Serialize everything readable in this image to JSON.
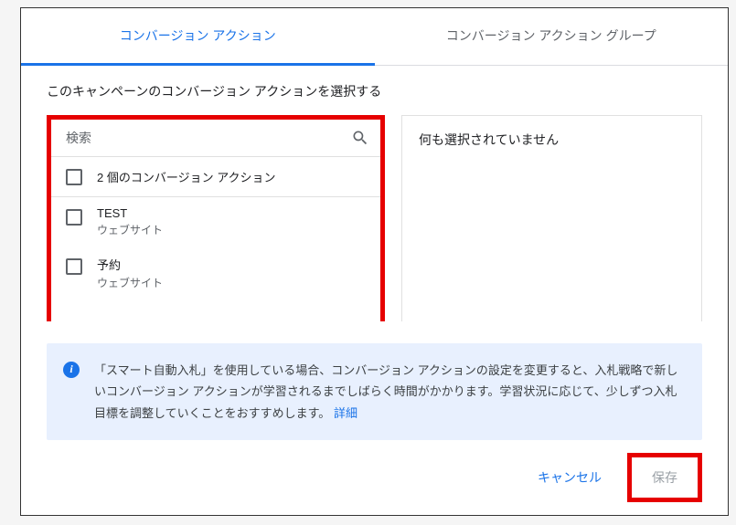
{
  "tabs": {
    "actions": "コンバージョン アクション",
    "groups": "コンバージョン アクション グループ"
  },
  "headline": "このキャンペーンのコンバージョン アクションを選択する",
  "search": {
    "placeholder": "検索"
  },
  "select_all": "2 個のコンバージョン アクション",
  "items": [
    {
      "name": "TEST",
      "sub": "ウェブサイト"
    },
    {
      "name": "予約",
      "sub": "ウェブサイト"
    }
  ],
  "right_empty": "何も選択されていません",
  "info": {
    "text": "「スマート自動入札」を使用している場合、コンバージョン アクションの設定を変更すると、入札戦略で新しいコンバージョン アクションが学習されるまでしばらく時間がかかります。学習状況に応じて、少しずつ入札目標を調整していくことをおすすめします。",
    "link": "詳細"
  },
  "footer": {
    "cancel": "キャンセル",
    "save": "保存"
  }
}
